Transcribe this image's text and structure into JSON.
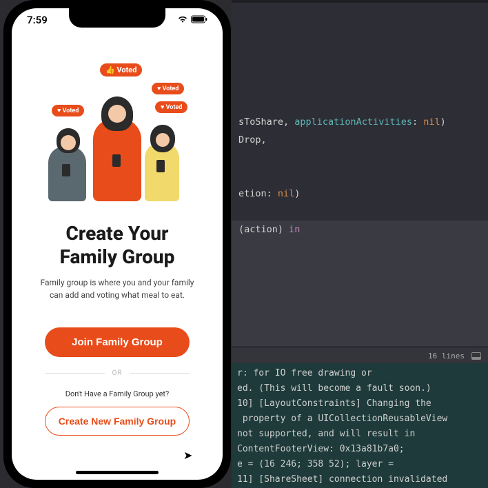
{
  "phone": {
    "status": {
      "time": "7:59"
    },
    "bubbles": {
      "voted": "Voted"
    },
    "title_line1": "Create Your",
    "title_line2": "Family Group",
    "subtitle": "Family group is where you and your family can add and voting what meal to eat.",
    "join_label": "Join Family Group",
    "divider": "OR",
    "prompt": "Don't Have a Family Group yet?",
    "create_label": "Create New Family Group"
  },
  "editor": {
    "lines_label": "16 lines",
    "seg1_a": "sToShare, ",
    "seg1_b": "applicationActivities",
    "seg1_c": ": ",
    "seg1_d": "nil",
    "seg1_e": ")",
    "seg2_a": "Drop,",
    "seg3_a": "etion: ",
    "seg3_b": "nil",
    "seg3_c": ")",
    "seg4_a": "(action) ",
    "seg4_b": "in"
  },
  "console": {
    "l1": "r: for IO free drawing or",
    "l2": "ed. (This will become a fault soon.)",
    "l3": "10] [LayoutConstraints] Changing the",
    "l4": " property of a UICollectionReusableView",
    "l5": "not supported, and will result in",
    "l6": "ContentFooterView: 0x13a81b7a0;",
    "l7": "e = (16 246; 358 52); layer =",
    "l8": "",
    "l9": "11] [ShareSheet] connection invalidated"
  }
}
